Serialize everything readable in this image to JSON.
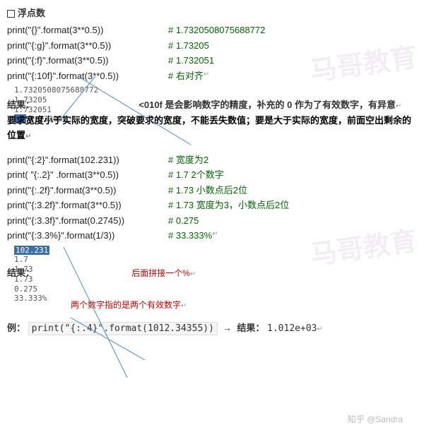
{
  "header": {
    "title": "浮点数"
  },
  "block1": {
    "rows": [
      {
        "code": "print(\"{}\".format(3**0.5))",
        "comment": "# 1.7320508075688772"
      },
      {
        "code": "print(\"{:g}\".format(3**0.5))",
        "comment": "# 1.73205"
      },
      {
        "code": "print(\"{:f}\".format(3**0.5))",
        "comment": "# 1.732051"
      },
      {
        "code": "print(\"{:10f}\".format(3**0.5))",
        "comment": "# 右对齐"
      }
    ],
    "output": [
      "1.7320508075688772",
      "1.73205",
      "1.732051",
      "  1.732051"
    ],
    "result_label": "结果：",
    "note_spec": "<010f",
    "note_after": " 是会影响数字的精度，补充的 0 作为了有效数字，有异意"
  },
  "mid_note": "要求宽度小于实际的宽度，突破要求的宽度，不能丢失数值；要是大于实际的宽度，前面空出剩余的位置",
  "block2": {
    "rows": [
      {
        "code": "print(\"{:2}\".format(102.231))",
        "comment": "# 宽度为2"
      },
      {
        "code": "print( \"{:.2}\" .format(3**0.5))",
        "comment": "# 1.7    2个数字"
      },
      {
        "code": "print(\"{:.2f}\".format(3**0.5))",
        "comment": "# 1.73   小数点后2位"
      },
      {
        "code": "print(\"{:3.2f}\".format(3**0.5))",
        "comment": "# 1.73   宽度为3，小数点后2位"
      },
      {
        "code": "print(\"{:3.3f}\".format(0.2745))",
        "comment": "# 0.275"
      },
      {
        "code": "print(\"{:3.3%}\".format(1/3))",
        "comment": "# 33.333%"
      }
    ],
    "output": [
      "102.231",
      "1.7",
      "1.73",
      "1.73",
      "0.275",
      "33.333%"
    ],
    "result_label": "结果：",
    "ann1": "后面拼接一个%",
    "ann2": "两个数字指的是两个有效数字"
  },
  "example": {
    "label": "例：",
    "code": "print(\"{:.4}\".format(1012.34355))",
    "arrow": "→",
    "result_label": "结果：",
    "result_value": "1.012e+03"
  }
}
